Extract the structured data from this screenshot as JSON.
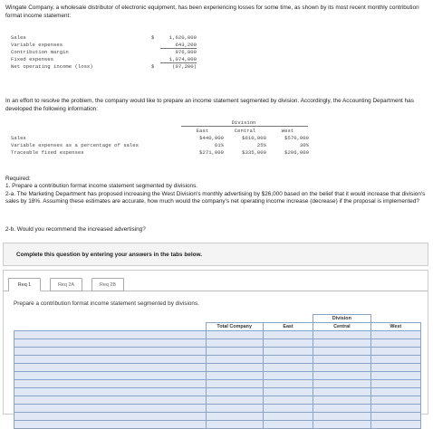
{
  "intro": "Wingate Company, a wholesale distributor of electronic equipment, has been experiencing losses for some time, as shown by its most recent monthly contribution format income statement:",
  "income_statement": [
    {
      "label": "Sales",
      "currency": "$",
      "value": "1,620,000"
    },
    {
      "label": "Variable expenses",
      "currency": "",
      "value": "643,200"
    },
    {
      "label": "Contribution margin",
      "currency": "",
      "value": "976,800"
    },
    {
      "label": "Fixed expenses",
      "currency": "",
      "value": "1,074,000"
    },
    {
      "label": "Net operating income (loss)",
      "currency": "$",
      "value": "(97,200)"
    }
  ],
  "effort_text": "In an effort to resolve the problem, the company would like to prepare an income statement segmented by division. Accordingly, the Accounting Department has developed the following information:",
  "division_table": {
    "title": "Division",
    "columns": [
      "East",
      "Central",
      "West"
    ],
    "rows": [
      {
        "label": "Sales",
        "values": [
          "$440,000",
          "$610,000",
          "$570,000"
        ]
      },
      {
        "label": "Variable expenses as a percentage of sales",
        "values": [
          "61%",
          "25%",
          "30%"
        ]
      },
      {
        "label": "Traceable fixed expenses",
        "values": [
          "$271,000",
          "$335,000",
          "$206,000"
        ]
      }
    ]
  },
  "required": {
    "heading": "Required:",
    "item1": "1. Prepare a contribution format income statement segmented by divisions.",
    "item2a": "2-a. The Marketing Department has proposed increasing the West Division's monthly advertising by $26,000 based on the belief that it would increase that division's sales by 18%. Assuming these estimates are accurate, how much would the company's net operating income increase (decrease) if the proposal is implemented?",
    "item2b": "2-b. Would you recommend the increased advertising?"
  },
  "complete_banner": "Complete this question by entering your answers in the tabs below.",
  "tabs": [
    "Req 1",
    "Req 2A",
    "Req 2B"
  ],
  "active_tab": "Req 1",
  "panel_prompt": "Prepare a contribution format income statement segmented by divisions.",
  "answer_table": {
    "division_label": "Division",
    "headers": [
      "Total Company",
      "East",
      "Central",
      "West"
    ],
    "row_count": 12
  },
  "colors": {
    "input_cell": "#dfe8f4",
    "input_border": "#8aa4c8"
  }
}
